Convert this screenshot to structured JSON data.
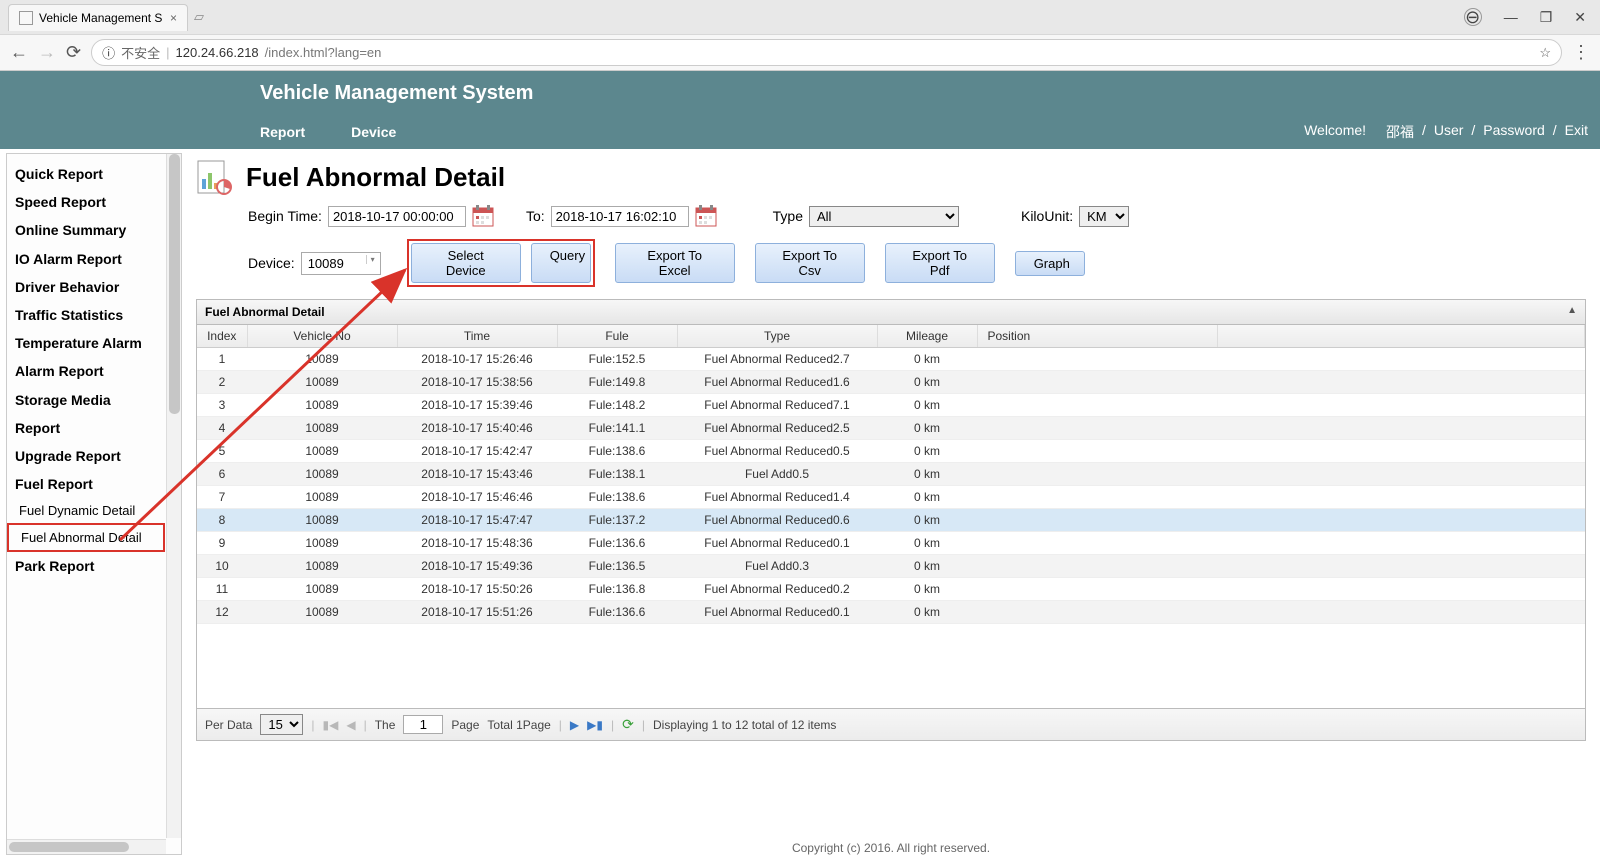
{
  "browser": {
    "tab_title": "Vehicle Management S",
    "url_insecure_label": "不安全",
    "url_host": "120.24.66.218",
    "url_path": "/index.html?lang=en"
  },
  "header": {
    "title": "Vehicle Management System",
    "nav": {
      "report": "Report",
      "device": "Device"
    },
    "welcome": "Welcome!",
    "user_name": "邵福",
    "links": {
      "user": "User",
      "password": "Password",
      "exit": "Exit"
    },
    "slash": "/"
  },
  "sidebar": {
    "items": [
      "Quick Report",
      "Speed Report",
      "Online Summary",
      "IO Alarm Report",
      "Driver Behavior",
      "Traffic Statistics",
      "Temperature Alarm",
      "Alarm Report",
      "Storage Media",
      "Report",
      "Upgrade Report",
      "Fuel Report"
    ],
    "sub": {
      "dynamic": "Fuel Dynamic Detail",
      "abnormal": "Fuel Abnormal Detail"
    },
    "cutoff": "Park Report"
  },
  "page": {
    "title": "Fuel Abnormal Detail"
  },
  "filters": {
    "begin_label": "Begin Time:",
    "begin_value": "2018-10-17 00:00:00",
    "to_label": "To:",
    "to_value": "2018-10-17 16:02:10",
    "type_label": "Type",
    "type_value": "All",
    "kilo_label": "KiloUnit:",
    "kilo_value": "KM",
    "device_label": "Device:",
    "device_value": "10089",
    "select_device_btn": "Select Device",
    "query_btn": "Query",
    "export_excel_btn": "Export To Excel",
    "export_csv_btn": "Export To Csv",
    "export_pdf_btn": "Export To Pdf",
    "graph_btn": "Graph"
  },
  "table": {
    "panel_title": "Fuel Abnormal Detail",
    "cols": {
      "index": "Index",
      "vehicle": "Vehicle No",
      "time": "Time",
      "fule": "Fule",
      "type": "Type",
      "mileage": "Mileage",
      "position": "Position"
    },
    "rows": [
      {
        "idx": "1",
        "veh": "10089",
        "time": "2018-10-17 15:26:46",
        "fule": "Fule:152.5",
        "type": "Fuel Abnormal Reduced2.7",
        "mil": "0 km",
        "pos": ""
      },
      {
        "idx": "2",
        "veh": "10089",
        "time": "2018-10-17 15:38:56",
        "fule": "Fule:149.8",
        "type": "Fuel Abnormal Reduced1.6",
        "mil": "0 km",
        "pos": ""
      },
      {
        "idx": "3",
        "veh": "10089",
        "time": "2018-10-17 15:39:46",
        "fule": "Fule:148.2",
        "type": "Fuel Abnormal Reduced7.1",
        "mil": "0 km",
        "pos": ""
      },
      {
        "idx": "4",
        "veh": "10089",
        "time": "2018-10-17 15:40:46",
        "fule": "Fule:141.1",
        "type": "Fuel Abnormal Reduced2.5",
        "mil": "0 km",
        "pos": ""
      },
      {
        "idx": "5",
        "veh": "10089",
        "time": "2018-10-17 15:42:47",
        "fule": "Fule:138.6",
        "type": "Fuel Abnormal Reduced0.5",
        "mil": "0 km",
        "pos": ""
      },
      {
        "idx": "6",
        "veh": "10089",
        "time": "2018-10-17 15:43:46",
        "fule": "Fule:138.1",
        "type": "Fuel Add0.5",
        "mil": "0 km",
        "pos": ""
      },
      {
        "idx": "7",
        "veh": "10089",
        "time": "2018-10-17 15:46:46",
        "fule": "Fule:138.6",
        "type": "Fuel Abnormal Reduced1.4",
        "mil": "0 km",
        "pos": ""
      },
      {
        "idx": "8",
        "veh": "10089",
        "time": "2018-10-17 15:47:47",
        "fule": "Fule:137.2",
        "type": "Fuel Abnormal Reduced0.6",
        "mil": "0 km",
        "pos": ""
      },
      {
        "idx": "9",
        "veh": "10089",
        "time": "2018-10-17 15:48:36",
        "fule": "Fule:136.6",
        "type": "Fuel Abnormal Reduced0.1",
        "mil": "0 km",
        "pos": ""
      },
      {
        "idx": "10",
        "veh": "10089",
        "time": "2018-10-17 15:49:36",
        "fule": "Fule:136.5",
        "type": "Fuel Add0.3",
        "mil": "0 km",
        "pos": ""
      },
      {
        "idx": "11",
        "veh": "10089",
        "time": "2018-10-17 15:50:26",
        "fule": "Fule:136.8",
        "type": "Fuel Abnormal Reduced0.2",
        "mil": "0 km",
        "pos": ""
      },
      {
        "idx": "12",
        "veh": "10089",
        "time": "2018-10-17 15:51:26",
        "fule": "Fule:136.6",
        "type": "Fuel Abnormal Reduced0.1",
        "mil": "0 km",
        "pos": ""
      }
    ]
  },
  "pager": {
    "per_label": "Per Data",
    "per_value": "15",
    "the_label": "The",
    "page_value": "1",
    "page_label": "Page",
    "total_pages": "Total 1Page",
    "summary": "Displaying 1 to 12 total of 12 items"
  },
  "footer": "Copyright (c) 2016. All right reserved."
}
